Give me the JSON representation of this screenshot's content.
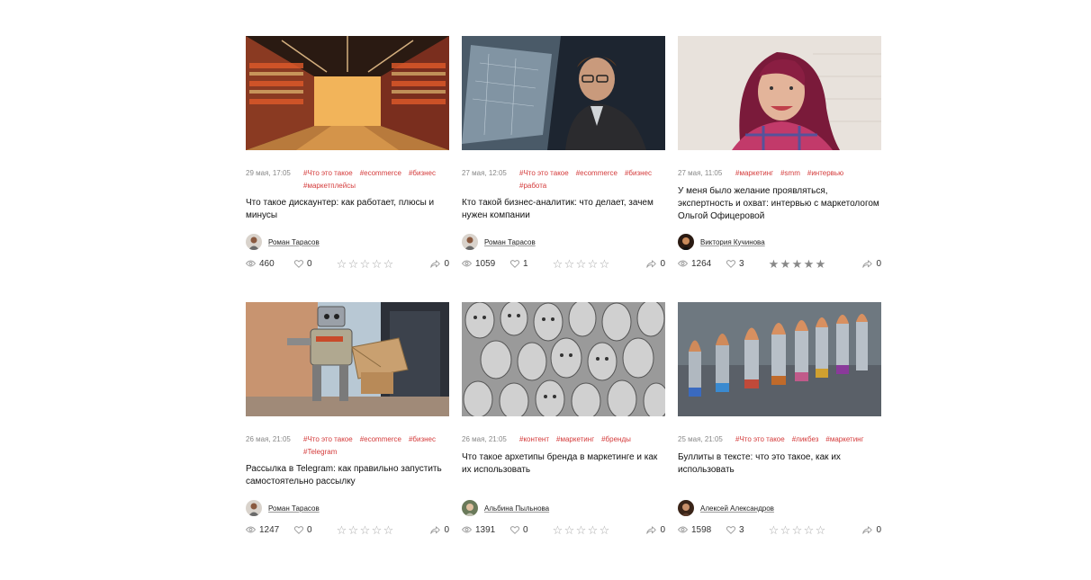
{
  "cards": [
    {
      "date": "29 мая, 17:05",
      "tags": [
        "#Что это такое",
        "#ecommerce",
        "#бизнес",
        "#маркетплейсы"
      ],
      "title": "Что такое дискаунтер: как работает, плюсы и минусы",
      "author": "Роман Тарасов",
      "views": "460",
      "likes": "0",
      "shares": "0",
      "rating": 0
    },
    {
      "date": "27 мая, 12:05",
      "tags": [
        "#Что это такое",
        "#ecommerce",
        "#бизнес",
        "#работа"
      ],
      "title": "Кто такой бизнес-аналитик: что делает, зачем нужен компании",
      "author": "Роман Тарасов",
      "views": "1059",
      "likes": "1",
      "shares": "0",
      "rating": 0
    },
    {
      "date": "27 мая, 11:05",
      "tags": [
        "#маркетинг",
        "#smm",
        "#интервью"
      ],
      "title": "У меня было желание проявляться, экспертность и охват: интервью с маркетологом Ольгой Офицеровой",
      "author": "Виктория Кучинова",
      "views": "1264",
      "likes": "3",
      "shares": "0",
      "rating": 5
    },
    {
      "date": "26 мая, 21:05",
      "tags": [
        "#Что это такое",
        "#ecommerce",
        "#бизнес",
        "#Telegram"
      ],
      "title": "Рассылка в Telegram: как правильно запустить самостоятельно рассылку",
      "author": "Роман Тарасов",
      "views": "1247",
      "likes": "0",
      "shares": "0",
      "rating": 0
    },
    {
      "date": "26 мая, 21:05",
      "tags": [
        "#контент",
        "#маркетинг",
        "#бренды"
      ],
      "title": "Что такое архетипы бренда в маркетинге и как их использовать",
      "author": "Альбина Пыльнова",
      "views": "1391",
      "likes": "0",
      "shares": "0",
      "rating": 0
    },
    {
      "date": "25 мая, 21:05",
      "tags": [
        "#Что это такое",
        "#ликбез",
        "#маркетинг"
      ],
      "title": "Буллиты в тексте: что это такое, как их использовать",
      "author": "Алексей Александров",
      "views": "1598",
      "likes": "3",
      "shares": "0",
      "rating": 0
    }
  ],
  "colors": {
    "tag": "#d43b3b",
    "muted": "#888888"
  }
}
